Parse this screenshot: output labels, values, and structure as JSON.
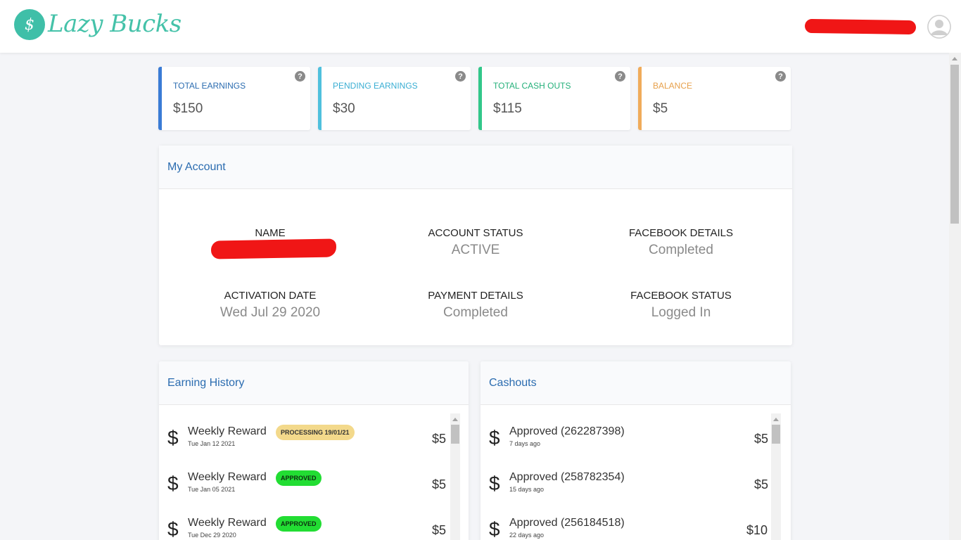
{
  "header": {
    "logo_text": "Lazy Bucks"
  },
  "stats": [
    {
      "label": "TOTAL EARNINGS",
      "value": "$150",
      "color": "#3a7bd5"
    },
    {
      "label": "PENDING EARNINGS",
      "value": "$30",
      "color": "#4fc0dd"
    },
    {
      "label": "TOTAL CASH OUTS",
      "value": "$115",
      "color": "#32c78a"
    },
    {
      "label": "BALANCE",
      "value": "$5",
      "color": "#f0ab5a"
    }
  ],
  "account": {
    "title": "My Account",
    "name_label": "NAME",
    "status_label": "ACCOUNT STATUS",
    "status_value": "ACTIVE",
    "fb_details_label": "FACEBOOK DETAILS",
    "fb_details_value": "Completed",
    "activation_label": "ACTIVATION DATE",
    "activation_value": "Wed Jul 29 2020",
    "payment_label": "PAYMENT DETAILS",
    "payment_value": "Completed",
    "fb_status_label": "FACEBOOK STATUS",
    "fb_status_value": "Logged In"
  },
  "earning_history": {
    "title": "Earning History",
    "rows": [
      {
        "title": "Weekly Reward",
        "date": "Tue Jan 12 2021",
        "badge": "PROCESSING 19/01/21",
        "amount": "$5"
      },
      {
        "title": "Weekly Reward",
        "date": "Tue Jan 05 2021",
        "badge": "APPROVED",
        "amount": "$5"
      },
      {
        "title": "Weekly Reward",
        "date": "Tue Dec 29 2020",
        "badge": "APPROVED",
        "amount": "$5"
      }
    ]
  },
  "cashouts": {
    "title": "Cashouts",
    "rows": [
      {
        "title": "Approved (262287398)",
        "date": "7 days ago",
        "amount": "$5"
      },
      {
        "title": "Approved (258782354)",
        "date": "15 days ago",
        "amount": "$5"
      },
      {
        "title": "Approved (256184518)",
        "date": "22 days ago",
        "amount": "$10"
      }
    ]
  },
  "colors": {
    "processing_badge": "#f3d98b",
    "approved_badge": "#22dd33",
    "accent_blue": "#2b6cb0"
  }
}
